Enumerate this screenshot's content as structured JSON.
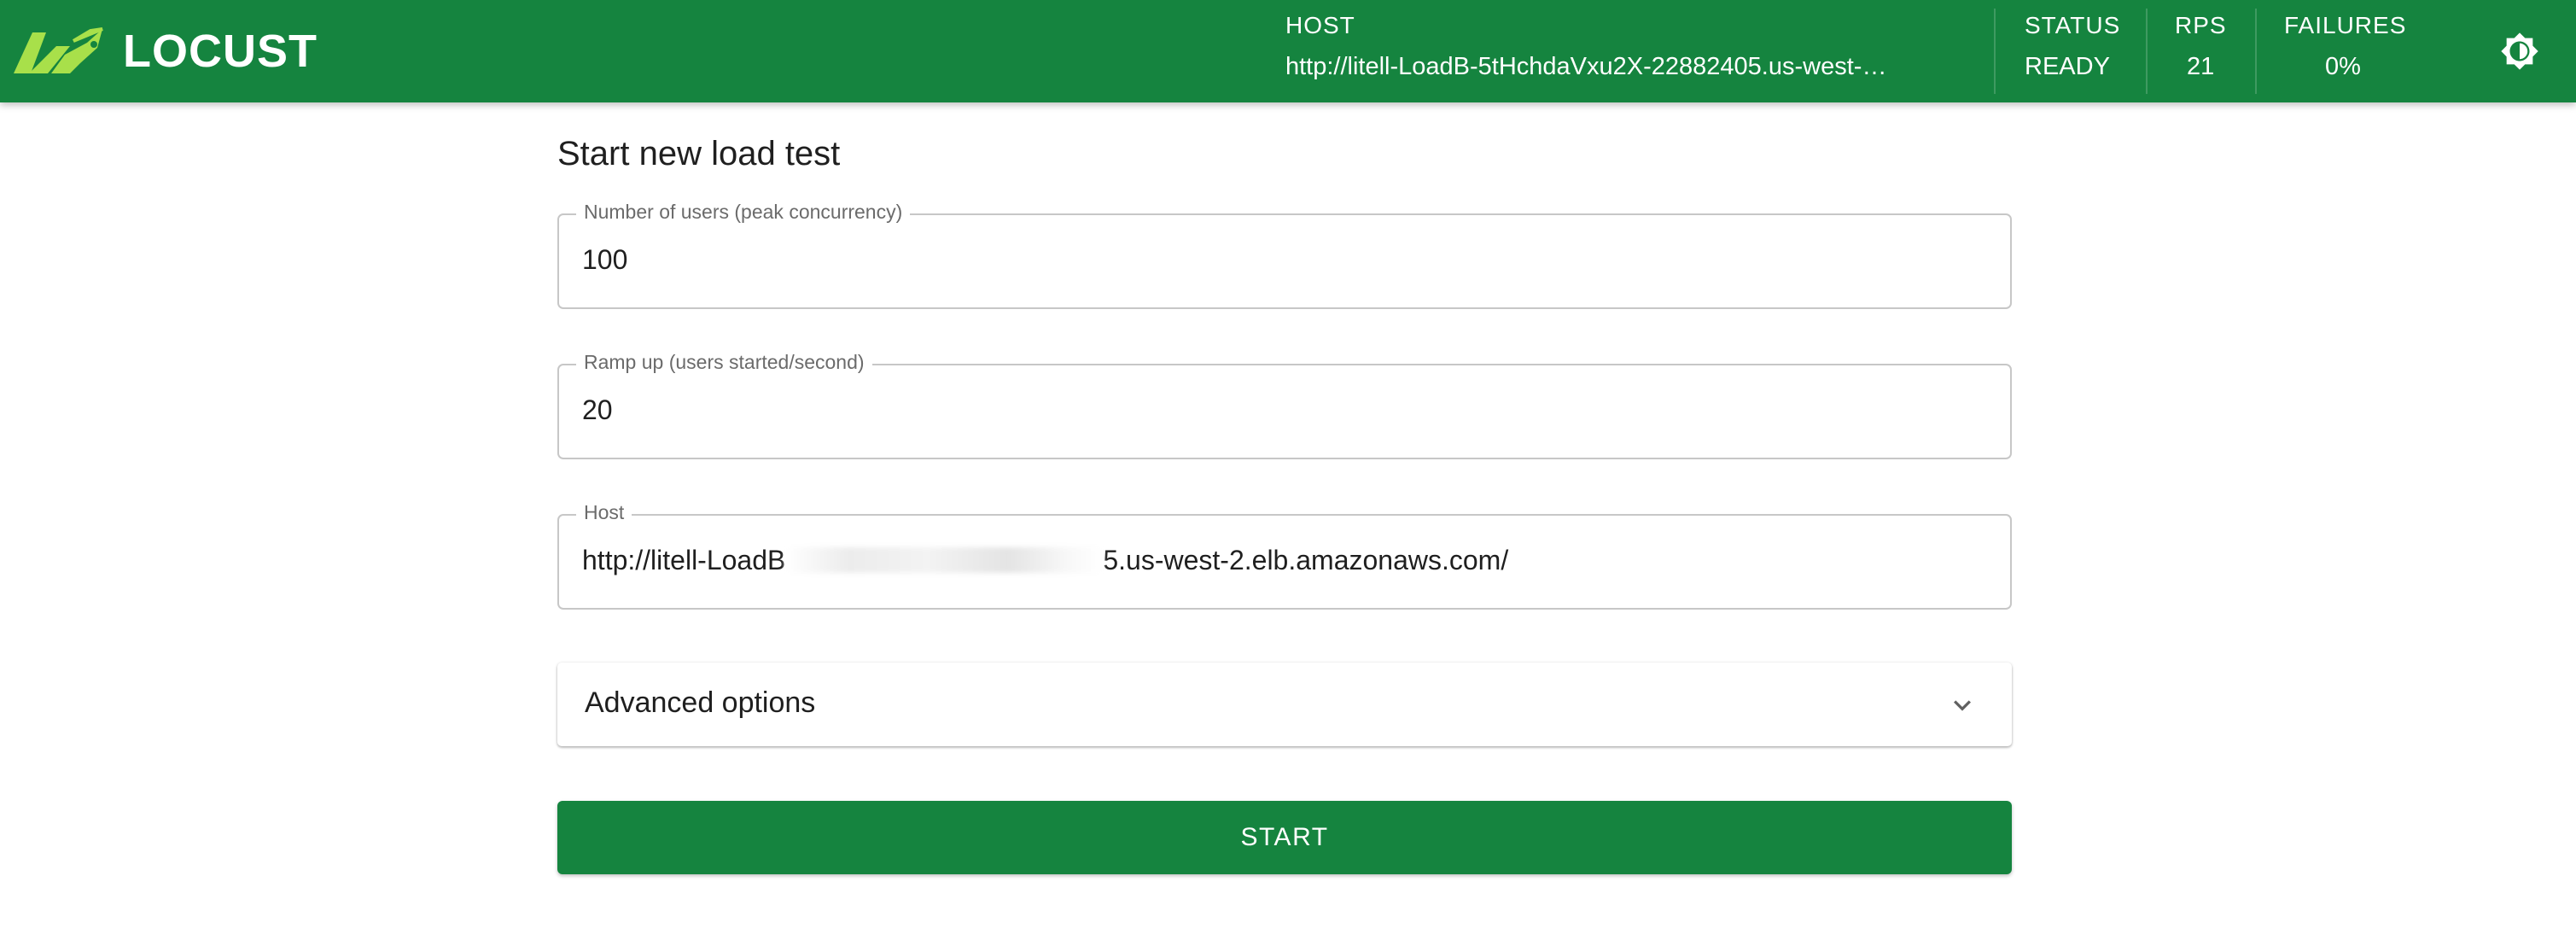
{
  "header": {
    "logo_text": "LOCUST",
    "host": {
      "label": "HOST",
      "value": "http://litell-LoadB-5tHchdaVxu2X-22882405.us-west-…"
    },
    "status": {
      "label": "STATUS",
      "value": "READY"
    },
    "rps": {
      "label": "RPS",
      "value": "21"
    },
    "failures": {
      "label": "FAILURES",
      "value": "0%"
    },
    "theme_toggle_icon": "brightness-icon"
  },
  "form": {
    "title": "Start new load test",
    "users": {
      "label": "Number of users (peak concurrency)",
      "value": "100"
    },
    "ramp_up": {
      "label": "Ramp up (users started/second)",
      "value": "20"
    },
    "host": {
      "label": "Host",
      "value_prefix": "http://litell-LoadB",
      "value_suffix": "5.us-west-2.elb.amazonaws.com/"
    },
    "advanced_options": {
      "label": "Advanced options",
      "icon": "chevron-down-icon"
    },
    "start_label": "START"
  },
  "colors": {
    "brand_green": "#15843f",
    "logo_lime": "#a8e04a"
  }
}
